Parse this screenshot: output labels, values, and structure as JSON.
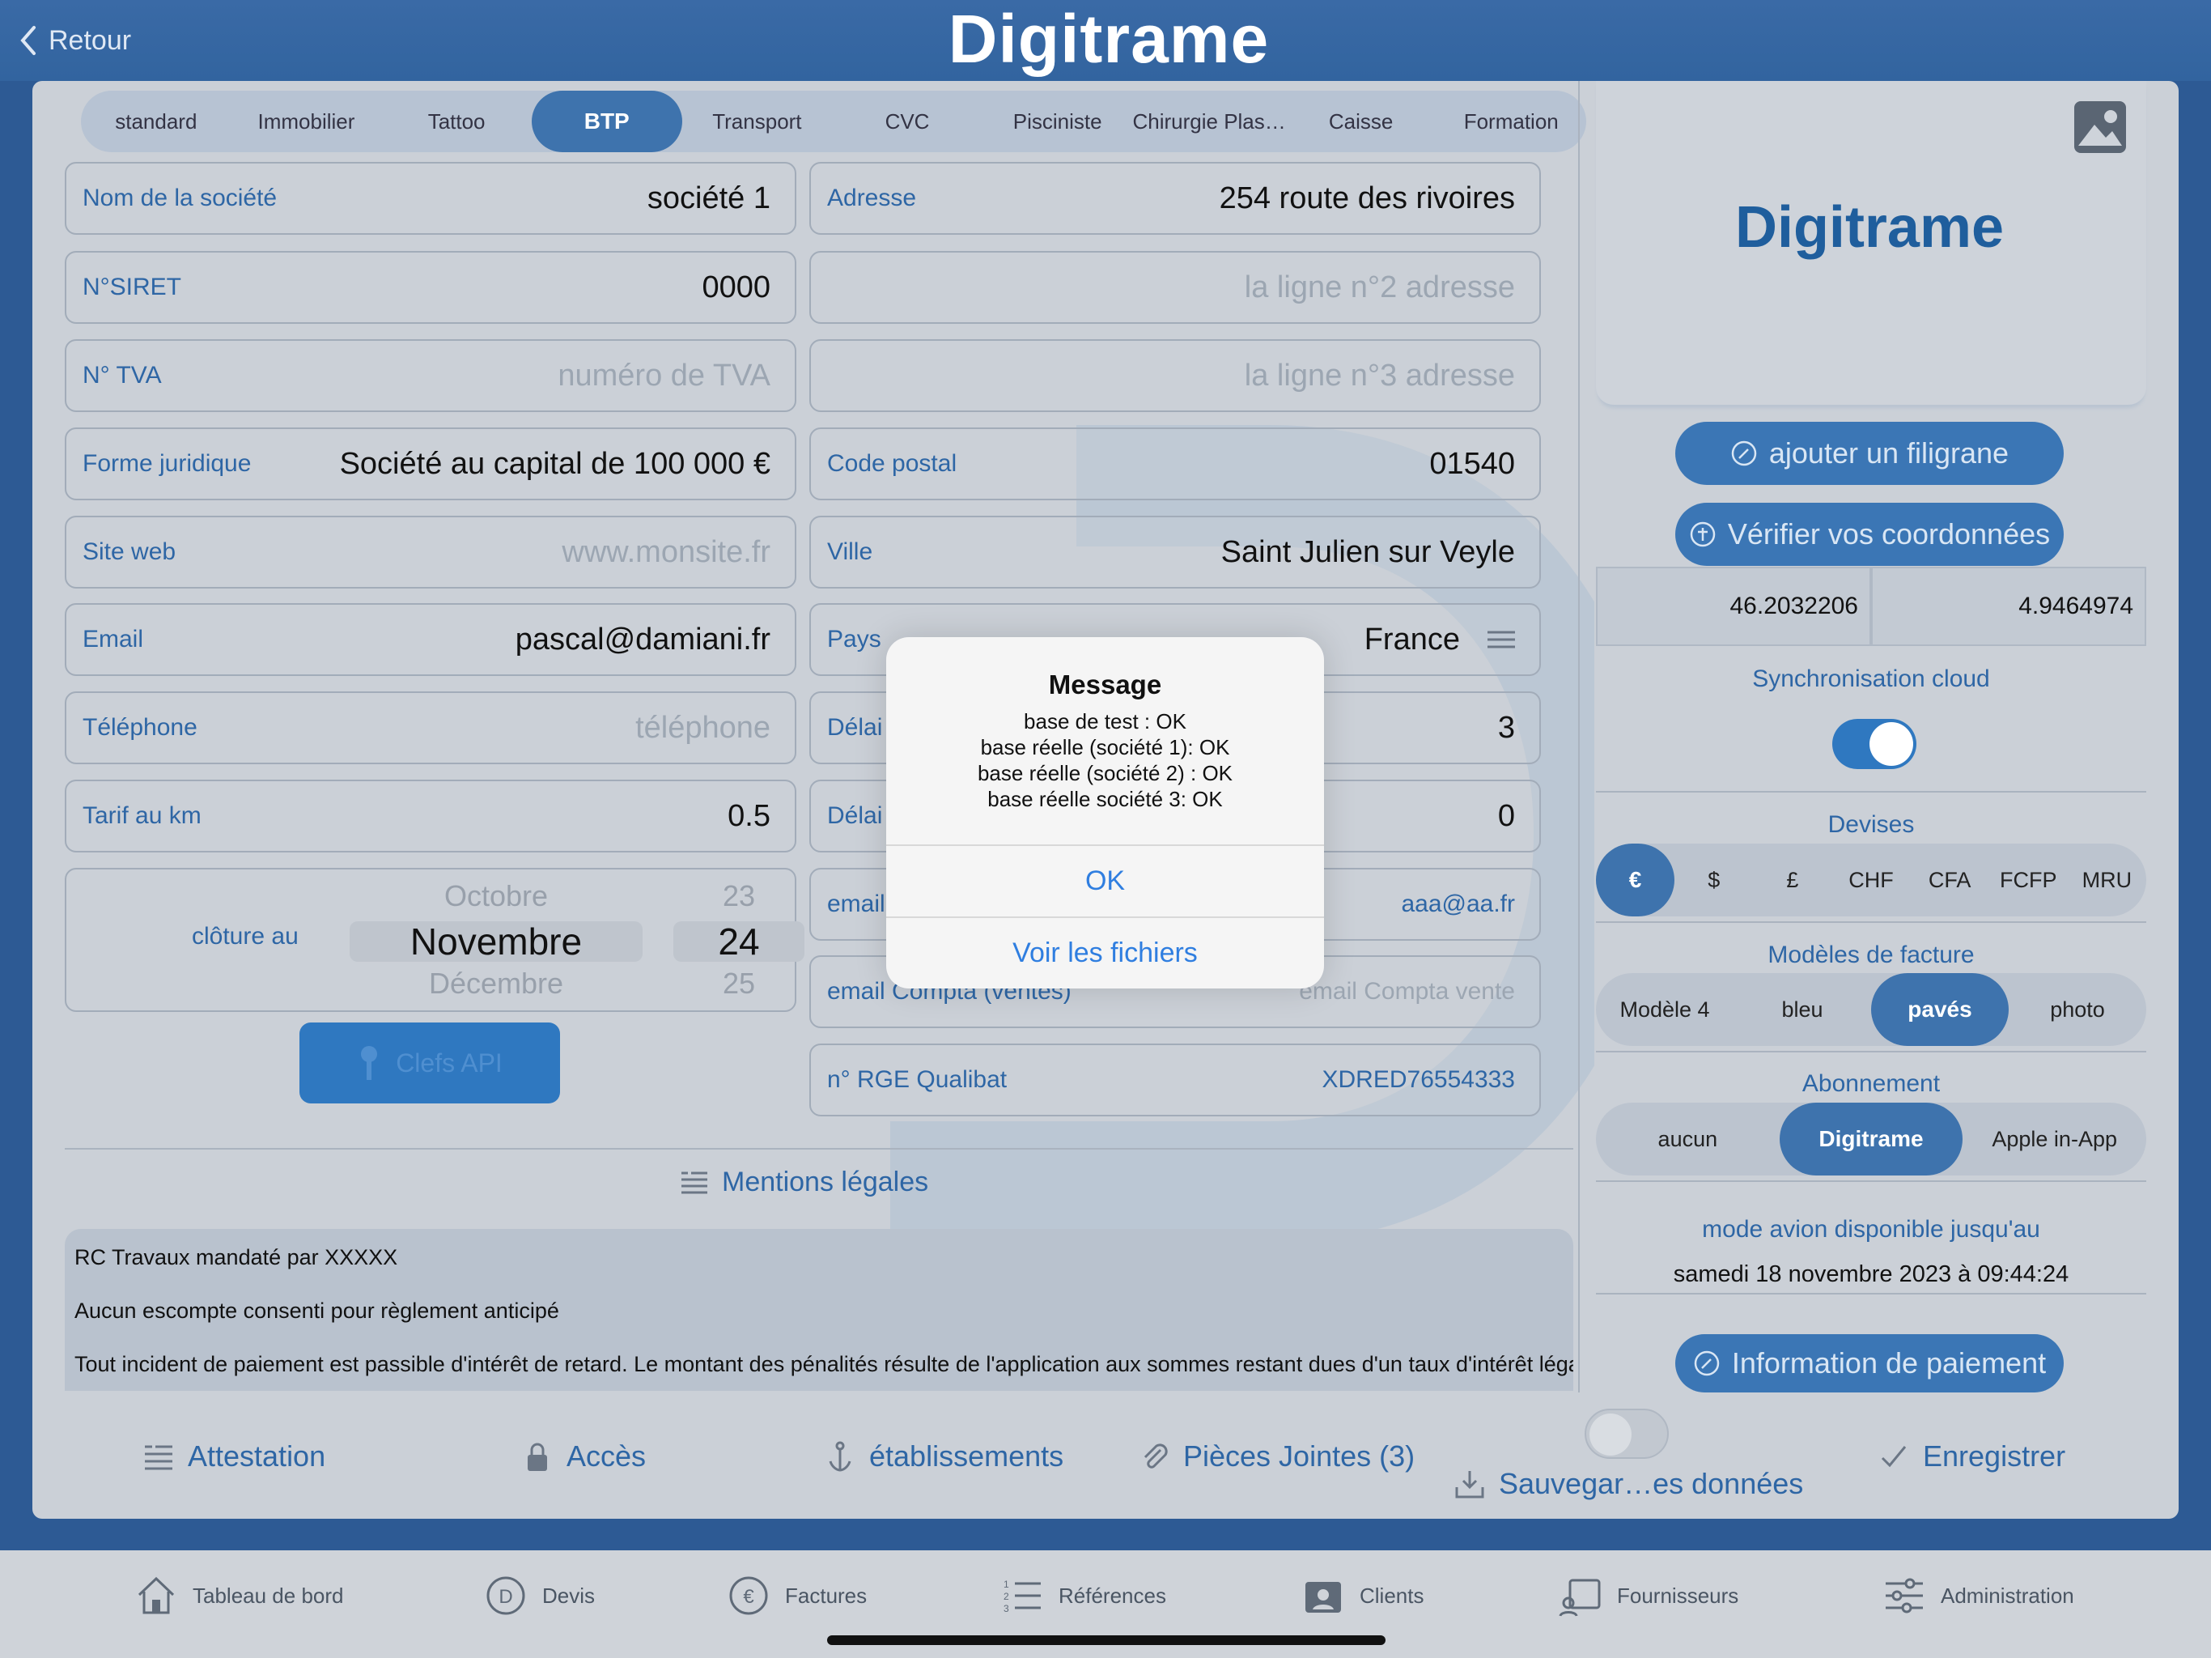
{
  "nav": {
    "back_label": "Retour",
    "app_title": "Digitrame"
  },
  "templates": {
    "items": [
      "standard",
      "Immobilier",
      "Tattoo",
      "BTP",
      "Transport",
      "CVC",
      "Pisciniste",
      "Chirurgie Plas…",
      "Caisse",
      "Formation"
    ],
    "selected": "BTP"
  },
  "fields": {
    "company_name": {
      "label": "Nom de la société",
      "value": "société 1"
    },
    "siret": {
      "label": "N°SIRET",
      "value": "0000"
    },
    "tva": {
      "label": "N° TVA",
      "placeholder": "numéro de TVA"
    },
    "legal_form": {
      "label": "Forme juridique",
      "value": "Société au capital de  100 000 €"
    },
    "website": {
      "label": "Site web",
      "placeholder": "www.monsite.fr"
    },
    "email": {
      "label": "Email",
      "value": "pascal@damiani.fr"
    },
    "phone": {
      "label": "Téléphone",
      "placeholder": "téléphone"
    },
    "km_rate": {
      "label": "Tarif au km",
      "value": "0.5"
    },
    "closing": {
      "label": "clôture au",
      "months": [
        "Octobre",
        "Novembre",
        "Décembre"
      ],
      "days": [
        "23",
        "24",
        "25"
      ]
    },
    "api_keys_label": "Clefs API",
    "address1": {
      "label": "Adresse",
      "value": "254 route des rivoires"
    },
    "address2": {
      "placeholder": "la ligne n°2 adresse"
    },
    "address3": {
      "placeholder": "la ligne n°3 adresse"
    },
    "postal_code": {
      "label": "Code postal",
      "value": "01540"
    },
    "city": {
      "label": "Ville",
      "value": "Saint Julien sur Veyle"
    },
    "country": {
      "label": "Pays",
      "value": "France"
    },
    "delay1": {
      "label": "Délai",
      "value": "3"
    },
    "delay2": {
      "label": "Délai",
      "value": "0"
    },
    "email2": {
      "label": "email",
      "value": "aaa@aa.fr"
    },
    "email_compta": {
      "label": "email Compta (ventes)",
      "placeholder": "email Compta vente"
    },
    "rge": {
      "label": "n° RGE Qualibat",
      "value": "XDRED76554333"
    }
  },
  "mentions": {
    "title": "Mentions légales",
    "lines": [
      "RC Travaux mandaté par XXXXX",
      "Aucun escompte consenti pour règlement anticipé",
      "Tout incident de paiement est passible d'intérêt de retard. Le montant des pénalités résulte de l'application aux sommes restant dues d'un taux d'intérêt légal en vigueur au moment de l'incident"
    ]
  },
  "side": {
    "logo_text": "Digitrame",
    "watermark_btn": "ajouter un filigrane",
    "verify_btn": "Vérifier vos coordonnées",
    "lat": "46.2032206",
    "lon": "4.9464974",
    "sync_title": "Synchronisation cloud",
    "sync_on": true,
    "currencies_title": "Devises",
    "currencies": [
      "€",
      "$",
      "£",
      "CHF",
      "CFA",
      "FCFP",
      "MRU"
    ],
    "currency_selected": "€",
    "models_title": "Modèles de facture",
    "models": [
      "Modèle 4",
      "bleu",
      "pavés",
      "photo"
    ],
    "model_selected": "pavés",
    "sub_title": "Abonnement",
    "subs": [
      "aucun",
      "Digitrame",
      "Apple in-App"
    ],
    "sub_selected": "Digitrame",
    "avion_title": "mode avion disponible jusqu'au",
    "avion_date": "samedi 18 novembre 2023 à 09:44:24",
    "payment_btn": "Information de paiement"
  },
  "toolbar": {
    "attestation": "Attestation",
    "acces": "Accès",
    "etablissements": "établissements",
    "pieces": "Pièces Jointes (3)",
    "sauvegarde": "Sauvegar…es données",
    "enregistrer": "Enregistrer"
  },
  "tabs": [
    "Tableau de bord",
    "Devis",
    "Factures",
    "Références",
    "Clients",
    "Fournisseurs",
    "Administration"
  ],
  "alert": {
    "title": "Message",
    "lines": [
      "base de test : OK",
      "base réelle (société 1): OK",
      "base réelle (société 2) : OK",
      "base réelle société 3: OK"
    ],
    "ok": "OK",
    "files": "Voir les fichiers"
  },
  "colors": {
    "accent": "#2e66a5",
    "selected": "#3e73ad",
    "header": "#32649f",
    "link": "#2f7ee0"
  }
}
